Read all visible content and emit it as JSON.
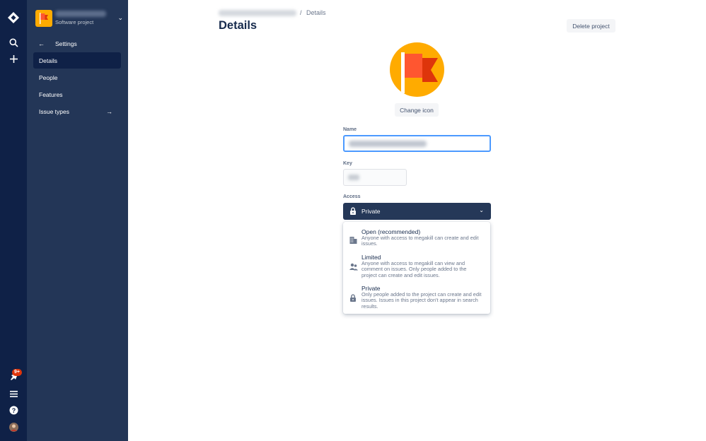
{
  "rail": {
    "icons": [
      "jira-logo-icon",
      "search-icon",
      "create-plus-icon",
      "notifications-icon",
      "menu-icon",
      "help-icon",
      "profile-avatar"
    ],
    "notification_badge": "9+"
  },
  "sidebar": {
    "project_type": "Software project",
    "back_label": "Settings",
    "items": [
      {
        "label": "Details",
        "active": true
      },
      {
        "label": "People",
        "active": false
      },
      {
        "label": "Features",
        "active": false
      },
      {
        "label": "Issue types",
        "active": false,
        "trailing_icon": "arrow-right-icon"
      }
    ]
  },
  "breadcrumb": {
    "separator": "/",
    "current": "Details"
  },
  "page": {
    "title": "Details",
    "delete_button": "Delete project",
    "change_icon_button": "Change icon"
  },
  "form": {
    "name_label": "Name",
    "key_label": "Key",
    "access_label": "Access",
    "access_selected": "Private"
  },
  "access_options": [
    {
      "title": "Open (recommended)",
      "description": "Anyone with access to megakill can create and edit issues.",
      "icon": "building-icon"
    },
    {
      "title": "Limited",
      "description": "Anyone with access to megakill can view and comment on issues. Only people added to the project can create and edit issues.",
      "icon": "people-icon"
    },
    {
      "title": "Private",
      "description": "Only people added to the project can create and edit issues. Issues in this project don't appear in search results.",
      "icon": "lock-icon"
    }
  ],
  "colors": {
    "rail": "#0f2147",
    "sidebar": "#233657",
    "sidebar_active": "#0f2147",
    "select": "#253858",
    "icon_bg": "#ffab00",
    "flag": "#ff5630",
    "focus_border": "#4c9aff",
    "badge": "#de350b"
  }
}
